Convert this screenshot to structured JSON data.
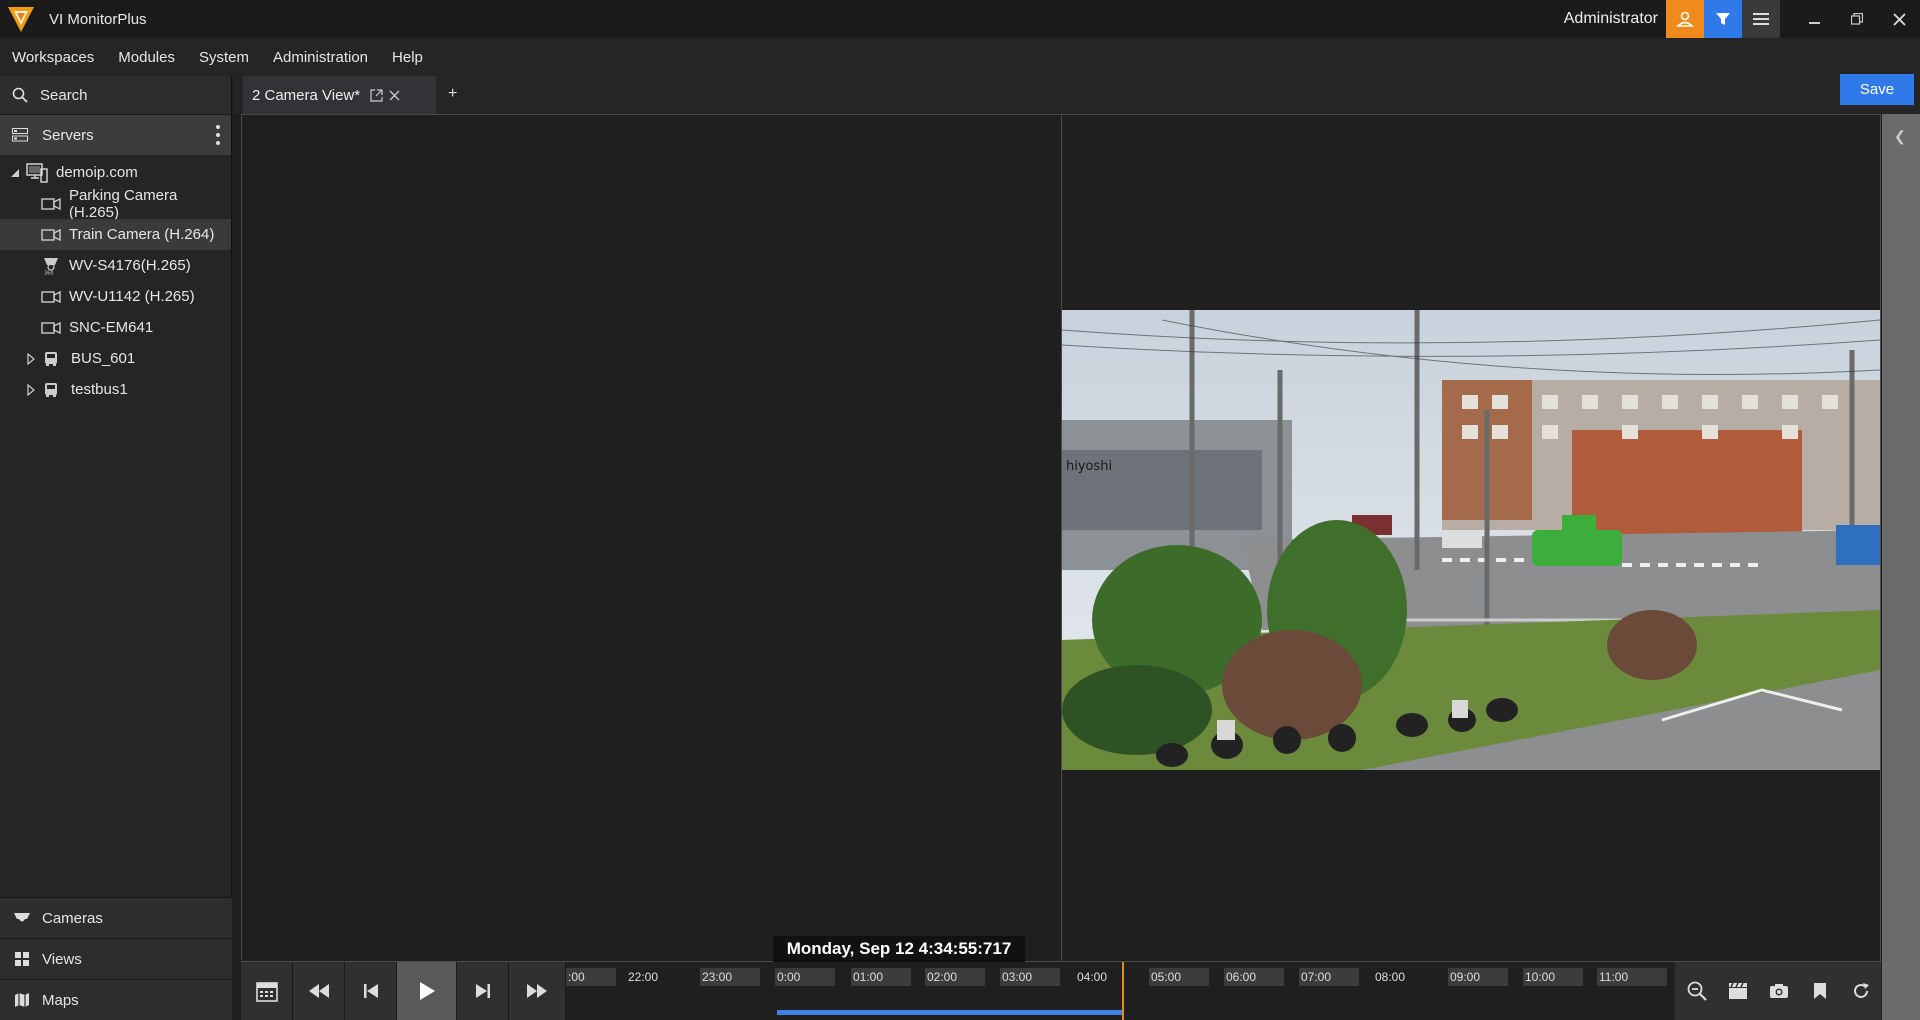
{
  "titlebar": {
    "app_title": "VI MonitorPlus",
    "user": "Administrator",
    "icons": [
      "user-icon",
      "filter-icon",
      "hamburger-menu-icon"
    ],
    "window_controls": [
      "minimize",
      "restore",
      "close"
    ]
  },
  "menu": [
    "Workspaces",
    "Modules",
    "System",
    "Administration",
    "Help"
  ],
  "sidebar": {
    "search_label": "Search",
    "servers_label": "Servers",
    "tree": {
      "server": "demoip.com",
      "cameras": [
        {
          "label": "Parking Camera (H.265)",
          "icon": "camera-icon",
          "selected": false
        },
        {
          "label": "Train Camera (H.264)",
          "icon": "camera-icon",
          "selected": true
        },
        {
          "label": "WV-S4176(H.265)",
          "icon": "camera-360-icon",
          "selected": false
        },
        {
          "label": "WV-U1142 (H.265)",
          "icon": "camera-icon",
          "selected": false
        },
        {
          "label": "SNC-EM641",
          "icon": "camera-icon",
          "selected": false
        }
      ],
      "groups": [
        {
          "label": "BUS_601",
          "icon": "bus-icon"
        },
        {
          "label": "testbus1",
          "icon": "bus-icon"
        }
      ]
    },
    "bottom_nav": [
      "Cameras",
      "Views",
      "Maps"
    ]
  },
  "tabs": {
    "active": "2 Camera View*",
    "add": "+"
  },
  "save_label": "Save",
  "playback": {
    "datetime": "Monday, Sep 12  4:34:55:717",
    "timeline_labels": [
      ":00",
      "22:00",
      "23:00",
      "0:00",
      "01:00",
      "02:00",
      "03:00",
      "04:00",
      "05:00",
      "06:00",
      "07:00",
      "08:00",
      "09:00",
      "10:00",
      "11:00"
    ],
    "shaded_labels": [
      ":00",
      "23:00",
      "0:00",
      "01:00",
      "02:00",
      "03:00",
      "05:00",
      "06:00",
      "07:00",
      "09:00",
      "10:00",
      "11:00"
    ]
  },
  "colors": {
    "accent_blue": "#2f79e8",
    "accent_orange": "#f08a1c",
    "timeline_progress": "#3f80e0",
    "cursor": "#e08a1a"
  }
}
